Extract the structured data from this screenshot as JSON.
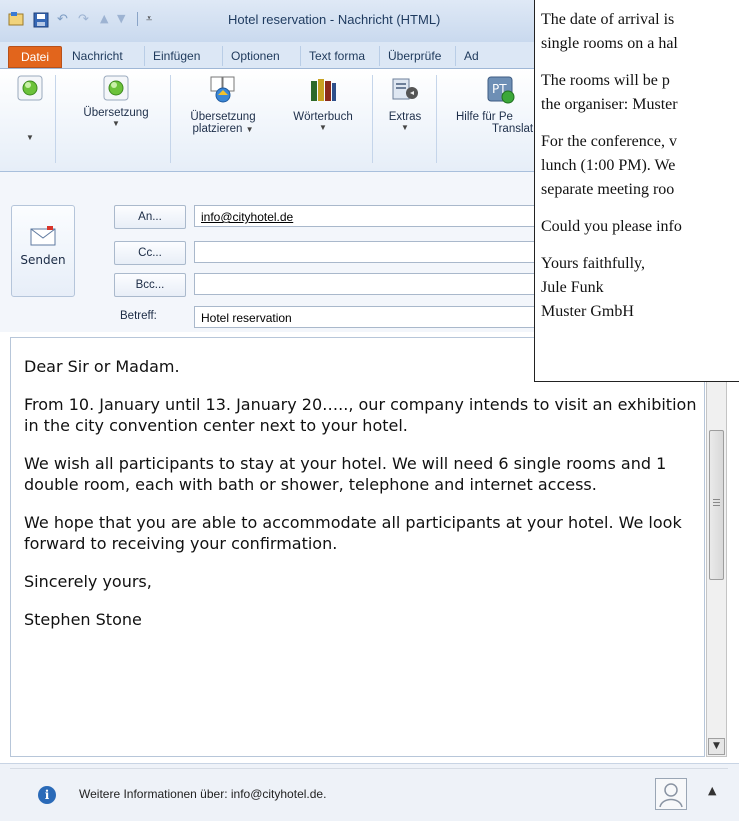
{
  "window": {
    "title": "Hotel reservation - Nachricht (HTML)"
  },
  "tabs": [
    "Datei",
    "Nachricht",
    "Einfügen",
    "Optionen",
    "Text forma",
    "Überprüfe",
    "Ad"
  ],
  "ribbon": {
    "buttons": [
      {
        "label": "",
        "icon": "circle-icon"
      },
      {
        "label": "Übersetzung",
        "icon": "circle-icon"
      },
      {
        "label": "Übersetzung platzieren",
        "icon": "translate-icon"
      },
      {
        "label": "Wörterbuch",
        "icon": "books-icon"
      },
      {
        "label": "Extras",
        "icon": "tools-icon"
      },
      {
        "label": "Hilfe für Pe Translat",
        "icon": "help-icon"
      }
    ],
    "btn_line1": [
      "Übersetzung",
      "Übersetzung",
      "Wörterbuch",
      "Extras",
      "Hilfe für Pe"
    ],
    "btn_line2": [
      "platzieren",
      "Translat"
    ]
  },
  "compose": {
    "send_label": "Senden",
    "to_button": "An...",
    "cc_button": "Cc...",
    "bcc_button": "Bcc...",
    "subject_label": "Betreff:",
    "to_value": "info@cityhotel.de",
    "cc_value": "",
    "bcc_value": "",
    "subject_value": "Hotel reservation"
  },
  "body": {
    "paragraphs": [
      "Dear Sir or Madam.",
      "From 10. January until 13. January 20….., our company intends to visit an exhibition in the city convention center next to your hotel.",
      "We wish all participants to stay at your hotel. We will need 6 single rooms and 1 double room, each with bath or shower, telephone and internet access.",
      "We hope that you are able to accommodate all participants at your hotel. We look forward to receiving your confirmation.",
      "Sincerely yours,",
      "Stephen Stone"
    ]
  },
  "infobar": {
    "text": "Weitere Informationen über: info@cityhotel.de."
  },
  "popup": {
    "lines": [
      "The date of arrival is",
      "single rooms on a hal",
      "The rooms will be p",
      "the organiser: Muster",
      "For the conference, v",
      "lunch (1:00 PM). We",
      "separate meeting roo",
      "Could you please info",
      "Yours faithfully,",
      "Jule Funk",
      "Muster GmbH"
    ]
  },
  "colors": {
    "datei_tab": "#e2651c",
    "ribbon_bg": "#e6eef8",
    "info_icon": "#2a6ab8"
  }
}
